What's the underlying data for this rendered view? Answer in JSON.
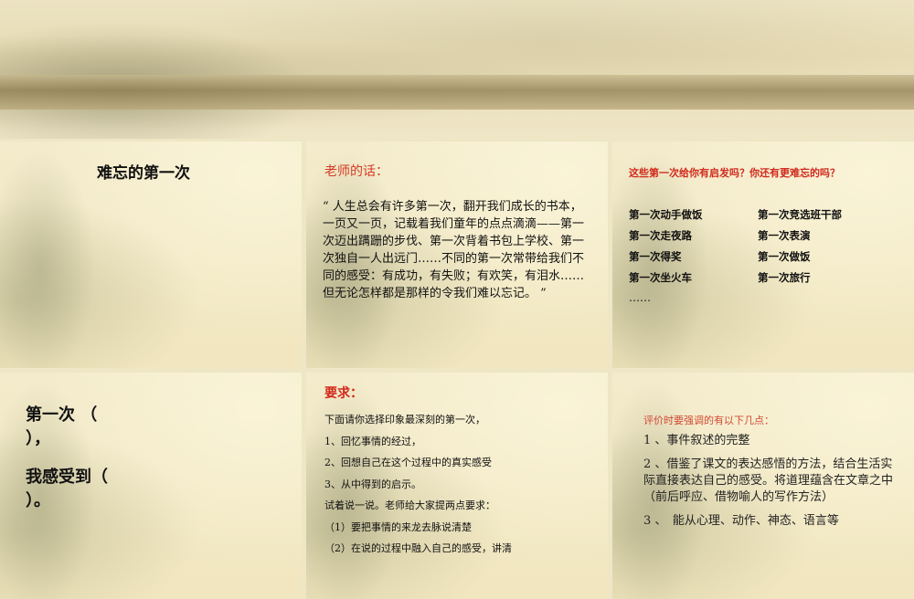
{
  "slides": {
    "s1": {
      "title": "难忘的第一次"
    },
    "s2": {
      "heading": "老师的话：",
      "body": "“ 人生总会有许多第一次，翻开我们成长的书本，一页又一页，记载着我们童年的点点滴滴——第一次迈出蹒跚的步伐、第一次背着书包上学校、第一次独自一人出远门……不同的第一次常带给我们不同的感受：有成功，有失败；有欢笑，有泪水……但无论怎样都是那样的令我们难以忘记。 ”"
    },
    "s3": {
      "heading": "这些第一次给你有启发吗？你还有更难忘的吗？",
      "items": [
        [
          "第一次动手做饭",
          "第一次竞选班干部"
        ],
        [
          "第一次走夜路",
          "第一次表演"
        ],
        [
          "第一次得奖",
          "第一次做饭"
        ],
        [
          "第一次坐火车",
          "第一次旅行"
        ]
      ],
      "ellipsis": "……"
    },
    "s4": {
      "line1": "第一次 （",
      "line2": "），",
      "line3": "我感受到（",
      "line4": "）。"
    },
    "s5": {
      "heading": "要求：",
      "lines": [
        "下面请你选择印象最深刻的第一次，",
        "1、回忆事情的经过，",
        "2、回想自己在这个过程中的真实感受",
        "3、从中得到的启示。",
        "试着说一说。老师给大家提两点要求：",
        "（1）要把事情的来龙去脉说清楚",
        "（2）在说的过程中融入自己的感受，讲清"
      ]
    },
    "s6": {
      "heading": "评价时要强调的有以下几点：",
      "points": [
        "1 、事件叙述的完整",
        "2 、借鉴了课文的表达感悟的方法，结合生活实际直接表达自己的感受。将道理蕴含在文章之中（前后呼应、借物喻人的写作方法）",
        "3 、　能从心理、动作、神态、语言等"
      ]
    }
  }
}
